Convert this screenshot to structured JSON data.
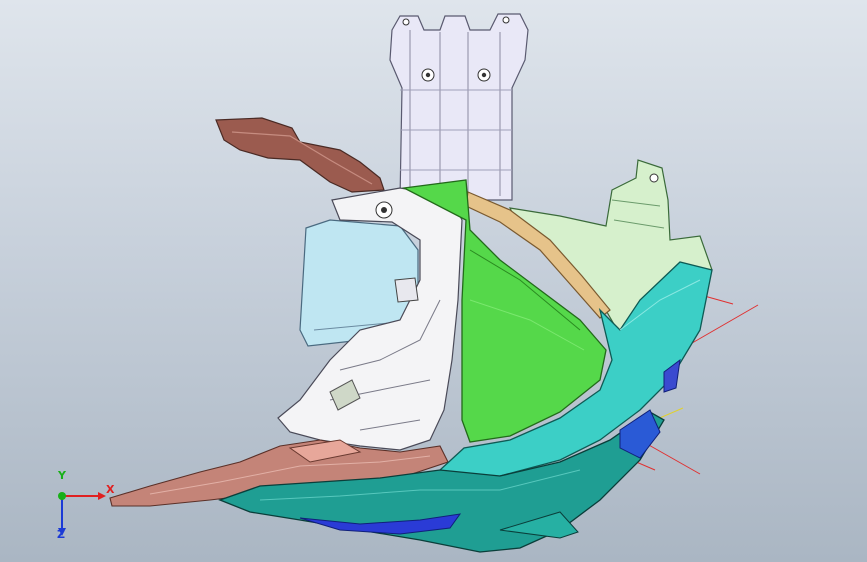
{
  "viewport": {
    "background_top": "#dfe5ec",
    "background_bottom": "#aab6c3"
  },
  "model": {
    "parts": [
      {
        "name": "mounting-bracket-column",
        "color": "#e9e8f7"
      },
      {
        "name": "brown-bracket-upper",
        "color": "#9b5b4f"
      },
      {
        "name": "brown-bracket-lower",
        "color": "#b7776c"
      },
      {
        "name": "light-blue-panel",
        "color": "#bfe6f2"
      },
      {
        "name": "white-frame",
        "color": "#f4f4f6"
      },
      {
        "name": "green-reflector",
        "color": "#55d84a"
      },
      {
        "name": "orange-rim",
        "color": "#e6c38a"
      },
      {
        "name": "light-green-housing",
        "color": "#d6f0cc"
      },
      {
        "name": "teal-lens",
        "color": "#3ccfc6"
      },
      {
        "name": "dark-teal-shell",
        "color": "#1f9e93"
      },
      {
        "name": "blue-lower-strip",
        "color": "#2a3bd6"
      }
    ]
  },
  "triad": {
    "x_label": "X",
    "y_label": "Y",
    "z_label": "Z",
    "x_color": "#e02020",
    "y_color": "#18b018",
    "z_color": "#1b3ad6"
  }
}
